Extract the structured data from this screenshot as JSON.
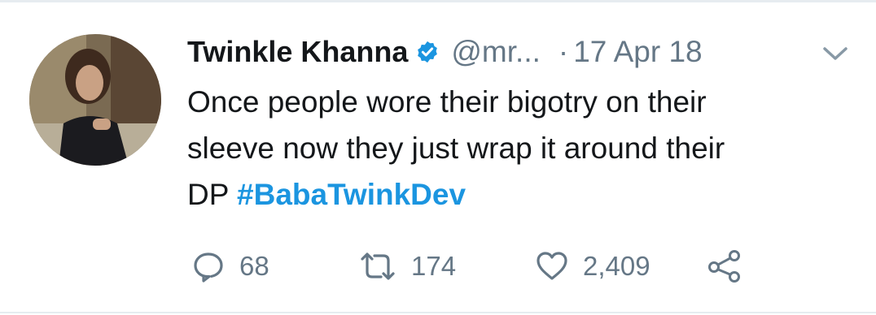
{
  "tweet": {
    "author_name": "Twinkle Khanna",
    "handle": "@mr...",
    "separator": "·",
    "date": "17 Apr 18",
    "text_lines": [
      "Once people wore their bigotry on their",
      "sleeve now they just wrap it around their"
    ],
    "text_tail": "DP",
    "hashtag": "#BabaTwinkDev",
    "verified": true
  },
  "actions": {
    "replies": "68",
    "retweets": "174",
    "likes": "2,409"
  },
  "icons": {
    "verified": "verified-badge-icon",
    "more": "chevron-down-icon",
    "reply": "reply-icon",
    "retweet": "retweet-icon",
    "like": "heart-icon",
    "share": "share-icon"
  },
  "colors": {
    "text": "#14171a",
    "secondary": "#657786",
    "accent": "#1b95e0",
    "divider": "#e6ecf0"
  }
}
